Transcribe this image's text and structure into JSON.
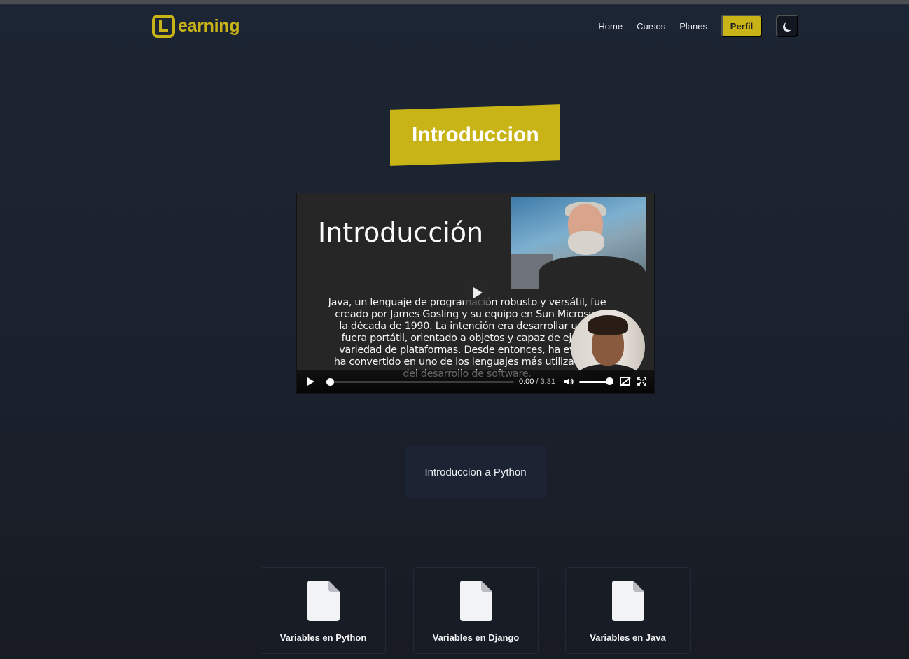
{
  "nav": {
    "logo_text": "earning",
    "links": [
      "Home",
      "Cursos",
      "Planes"
    ],
    "perfil_label": "Perfil",
    "brand_color": "#c9b417"
  },
  "page": {
    "title": "Introduccion"
  },
  "video": {
    "slide_title": "Introducción",
    "slide_text": "Java, un lenguaje de programación robusto y versátil, fue\ncreado por James Gosling y su equipo en Sun Microsys\nla década de 1990. La intención era desarrollar un le\nfuera portátil, orientado a objetos y capaz de ejecut\nvariedad de plataformas. Desde entonces, ha evoluc\nha convertido en uno de los lenguajes más utilizados d\ndel desarrollo de software.",
    "current_time": "0:00",
    "duration": "3:31",
    "progress_fraction": 0.0,
    "volume_fraction": 1.0
  },
  "lesson": {
    "label": "Introduccion a Python"
  },
  "cards": [
    {
      "label": "Variables en Python",
      "icon": "document-icon"
    },
    {
      "label": "Variables en Django",
      "icon": "document-icon"
    },
    {
      "label": "Variables en Java",
      "icon": "document-icon"
    }
  ]
}
